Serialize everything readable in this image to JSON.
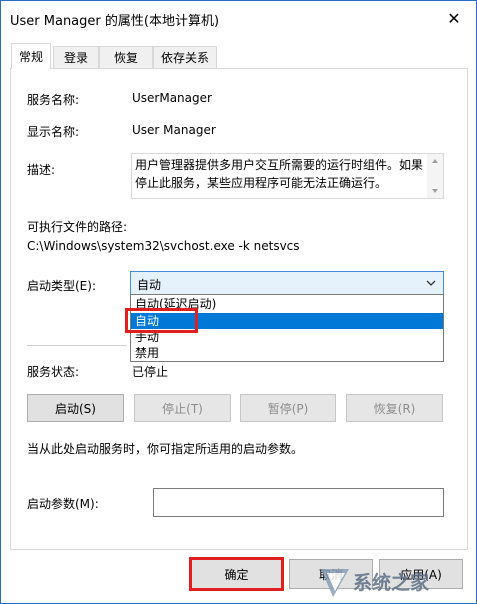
{
  "window": {
    "title": "User Manager 的属性(本地计算机)",
    "close_glyph": "✕"
  },
  "tabs": [
    {
      "label": "常规",
      "active": true
    },
    {
      "label": "登录"
    },
    {
      "label": "恢复"
    },
    {
      "label": "依存关系"
    }
  ],
  "general": {
    "service_name_label": "服务名称:",
    "service_name_value": "UserManager",
    "display_name_label": "显示名称:",
    "display_name_value": "User Manager",
    "description_label": "描述:",
    "description_value": "用户管理器提供多用户交互所需要的运行时组件。如果停止此服务，某些应用程序可能无法正确运行。",
    "path_label": "可执行文件的路径:",
    "path_value": "C:\\Windows\\system32\\svchost.exe -k netsvcs",
    "startup_type_label": "启动类型(E):",
    "startup_type_value": "自动",
    "startup_options": [
      "自动(延迟启动)",
      "自动",
      "手动",
      "禁用"
    ],
    "selected_option_index": 1,
    "status_label": "服务状态:",
    "status_value": "已停止",
    "buttons": {
      "start": "启动(S)",
      "stop": "停止(T)",
      "pause": "暂停(P)",
      "resume": "恢复(R)"
    },
    "hint_text": "当从此处启动服务时，你可指定所适用的启动参数。",
    "param_label": "启动参数(M):",
    "param_value": ""
  },
  "footer": {
    "ok_label": "确定",
    "cancel_label": "取消",
    "apply_label": "应用(A)"
  },
  "watermark": {
    "text": "系统之家"
  },
  "colors": {
    "accent": "#0078d7",
    "highlight_box": "#e02020",
    "window_border": "#2b6cc4"
  },
  "icons": {
    "close": "close-icon",
    "dropdown": "chevron-down-icon",
    "scroll_up": "scroll-up-icon",
    "scroll_down": "scroll-down-icon"
  }
}
